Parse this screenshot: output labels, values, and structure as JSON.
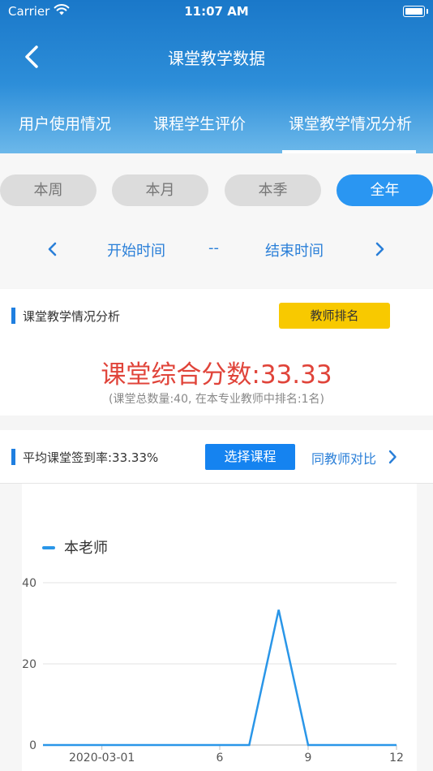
{
  "status_bar": {
    "carrier": "Carrier",
    "time": "11:07 AM"
  },
  "header": {
    "title": "课堂教学数据",
    "tabs": [
      {
        "label": "用户使用情况"
      },
      {
        "label": "课程学生评价"
      },
      {
        "label": "课堂教学情况分析",
        "active": true
      }
    ]
  },
  "periods": {
    "options": [
      "本周",
      "本月",
      "本季",
      "全年"
    ],
    "selected": "全年"
  },
  "date_range": {
    "start": "开始时间",
    "separator": "--",
    "end": "结束时间"
  },
  "analysis": {
    "section_title": "课堂教学情况分析",
    "rank_button": "教师排名",
    "score_text": "课堂综合分数:33.33",
    "score_detail": "(课堂总数量:40, 在本专业教师中排名:1名)"
  },
  "attendance": {
    "section_title": "平均课堂签到率:33.33%",
    "select_course_button": "选择课程",
    "compare_link": "同教师对比"
  },
  "colors": {
    "accent": "#1583f0",
    "header_top": "#1a78c9",
    "score_red": "#e0443a",
    "rank_yellow": "#f8c900",
    "line_blue": "#2a96e8"
  },
  "icons": {
    "back": "chevron-left-icon",
    "prev": "chevron-left-icon",
    "next": "chevron-right-icon",
    "wifi": "wifi-icon",
    "battery": "battery-icon"
  },
  "chart_data": {
    "type": "line",
    "x": [
      0,
      1,
      2,
      3,
      4,
      5,
      6,
      7,
      8,
      9,
      10,
      11,
      12
    ],
    "x_tick_labels": [
      {
        "x": 2,
        "label": "2020-03-01"
      },
      {
        "x": 6,
        "label": "6"
      },
      {
        "x": 9,
        "label": "9"
      },
      {
        "x": 12,
        "label": "12"
      }
    ],
    "series": [
      {
        "name": "本老师",
        "values": [
          0,
          0,
          0,
          0,
          0,
          0,
          0,
          0,
          33.33,
          0,
          0,
          0,
          0
        ]
      }
    ],
    "y_ticks": [
      0,
      20,
      40
    ],
    "ylim": [
      0,
      40
    ],
    "xlim": [
      0,
      12
    ],
    "grid": true,
    "legend": "top-left"
  }
}
